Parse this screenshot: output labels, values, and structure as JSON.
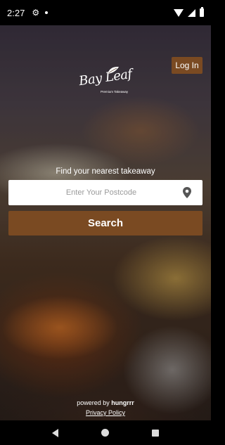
{
  "status_bar": {
    "time": "2:27",
    "icons": [
      "gear-icon",
      "notification-dot-icon",
      "wifi-icon",
      "signal-icon",
      "battery-icon"
    ]
  },
  "header": {
    "login_label": "Log In"
  },
  "logo": {
    "script_text": "Bay Leaf",
    "tagline": "Premium Takeaway"
  },
  "search": {
    "heading": "Find your nearest takeaway",
    "placeholder": "Enter Your Postcode",
    "value": "",
    "button_label": "Search",
    "location_icon": "map-pin-icon"
  },
  "footer": {
    "powered_prefix": "powered by",
    "powered_brand": "hungrrr",
    "privacy_label": "Privacy Policy"
  },
  "nav_bar": {
    "buttons": [
      "back-icon",
      "home-icon",
      "recents-icon"
    ]
  },
  "colors": {
    "accent": "#7a4a22",
    "text_on_dark": "#ffffff"
  }
}
